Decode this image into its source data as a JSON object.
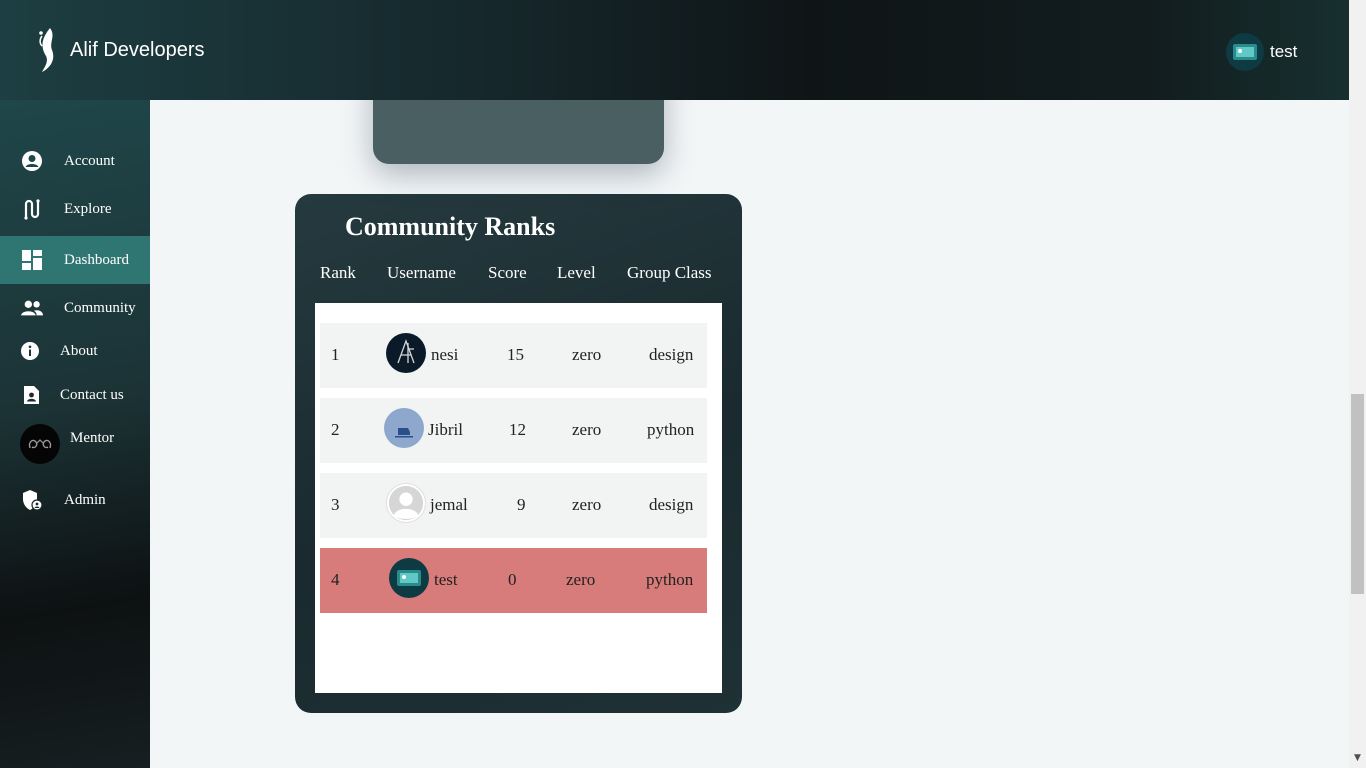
{
  "header": {
    "brand": "Alif Developers",
    "user_name": "test"
  },
  "sidebar": {
    "items": [
      {
        "label": "Account",
        "icon": "account-circle-icon"
      },
      {
        "label": "Explore",
        "icon": "route-icon"
      },
      {
        "label": "Dashboard",
        "icon": "dashboard-grid-icon",
        "active": true
      },
      {
        "label": "Community",
        "icon": "people-icon"
      },
      {
        "label": "About",
        "icon": "info-icon"
      },
      {
        "label": "Contact us",
        "icon": "contact-card-icon"
      },
      {
        "label": "Mentor",
        "icon": "mentor-avatar"
      },
      {
        "label": "Admin",
        "icon": "admin-shield-icon"
      }
    ]
  },
  "ranks": {
    "title": "Community Ranks",
    "columns": [
      "Rank",
      "Username",
      "Score",
      "Level",
      "Group Class"
    ],
    "rows": [
      {
        "rank": "1",
        "username": "nesi",
        "score": "15",
        "level": "zero",
        "group": "design"
      },
      {
        "rank": "2",
        "username": "Jibril",
        "score": "12",
        "level": "zero",
        "group": "python"
      },
      {
        "rank": "3",
        "username": "jemal",
        "score": "9",
        "level": "zero",
        "group": "design"
      },
      {
        "rank": "4",
        "username": "test",
        "score": "0",
        "level": "zero",
        "group": "python"
      }
    ]
  },
  "colors": {
    "active_nav": "#2f7672",
    "current_user_row": "#d77b7b",
    "card_dark": "#1a2a2e"
  }
}
